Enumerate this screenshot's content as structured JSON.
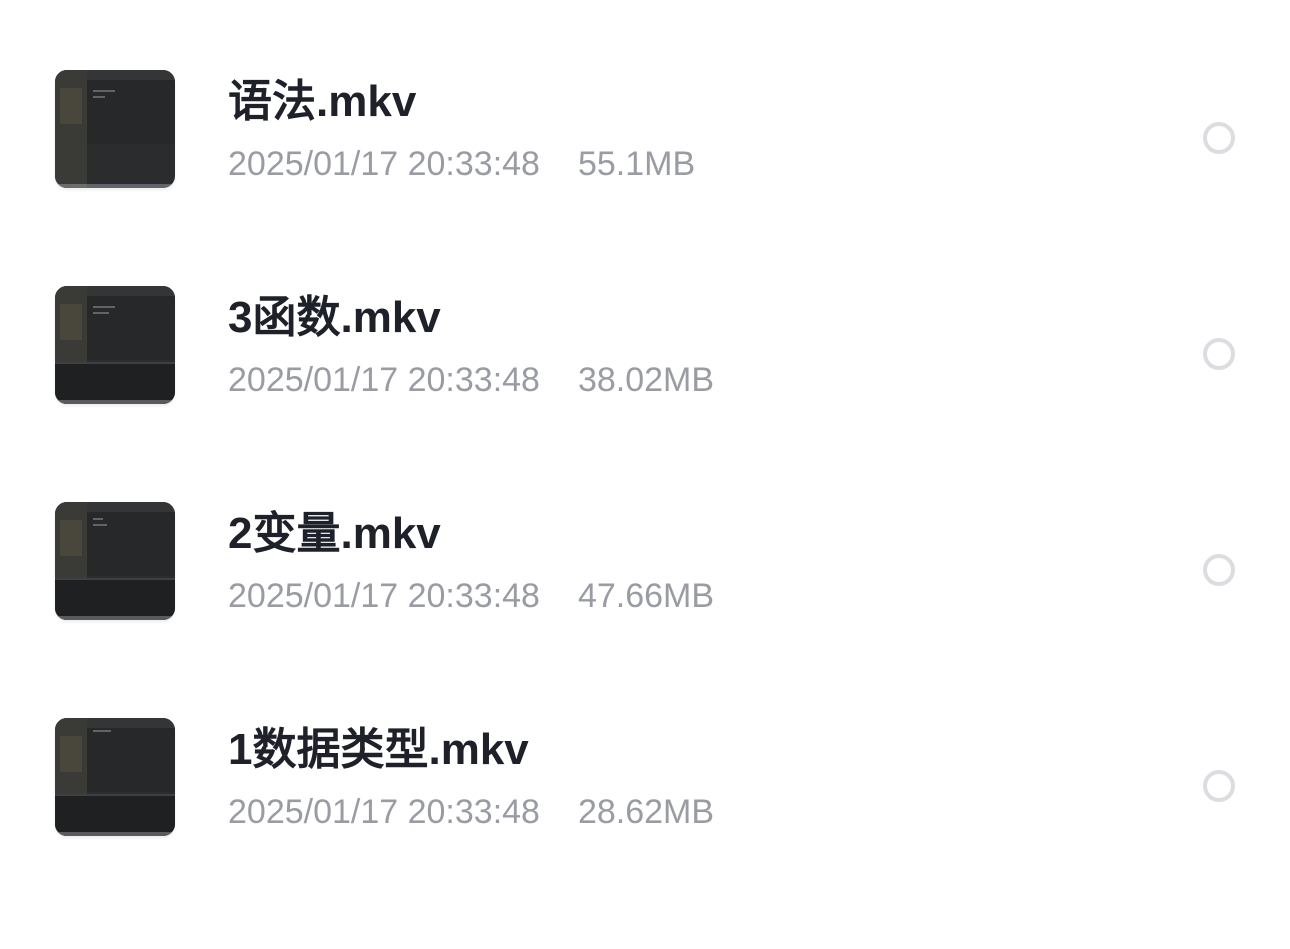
{
  "files": [
    {
      "name": "语法.mkv",
      "datetime": "2025/01/17 20:33:48",
      "size": "55.1MB",
      "icon": "video-thumbnail-icon",
      "selected": false
    },
    {
      "name": "3函数.mkv",
      "datetime": "2025/01/17 20:33:48",
      "size": "38.02MB",
      "icon": "video-thumbnail-icon",
      "selected": false
    },
    {
      "name": "2变量.mkv",
      "datetime": "2025/01/17 20:33:48",
      "size": "47.66MB",
      "icon": "video-thumbnail-icon",
      "selected": false
    },
    {
      "name": "1数据类型.mkv",
      "datetime": "2025/01/17 20:33:48",
      "size": "28.62MB",
      "icon": "video-thumbnail-icon",
      "selected": false
    }
  ],
  "colors": {
    "background": "#ffffff",
    "title_text": "#1e2129",
    "meta_text": "#9a9ca3",
    "radio_border": "#dcdde1",
    "thumbnail_dark": "#2b2c2e"
  }
}
